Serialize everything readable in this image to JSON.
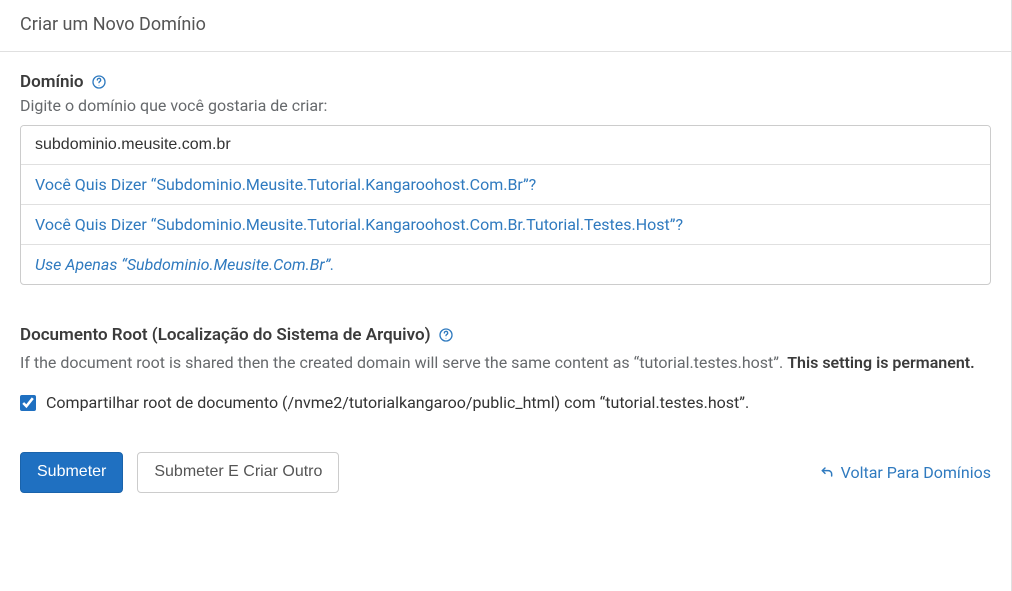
{
  "header": {
    "title": "Criar um Novo Domínio"
  },
  "domain": {
    "label": "Domínio",
    "helpText": "Digite o domínio que você gostaria de criar:",
    "value": "subdominio.meusite.com.br",
    "suggestions": [
      "Você Quis Dizer “Subdominio.Meusite.Tutorial.Kangaroohost.Com.Br”?",
      "Você Quis Dizer “Subdominio.Meusite.Tutorial.Kangaroohost.Com.Br.Tutorial.Testes.Host”?"
    ],
    "useOnly": "Use Apenas “Subdominio.Meusite.Com.Br”."
  },
  "docroot": {
    "label": "Documento Root (Localização do Sistema de Arquivo)",
    "helpPart1": "If the document root is shared then the created domain will serve the same content as “tutorial.testes.host”. ",
    "helpStrong": "This setting is permanent.",
    "checkboxLabel": "Compartilhar root de documento (/nvme2/tutorialkangaroo/public_html) com “tutorial.testes.host”."
  },
  "buttons": {
    "submit": "Submeter",
    "submitAnother": "Submeter E Criar Outro",
    "back": "Voltar Para Domínios"
  }
}
